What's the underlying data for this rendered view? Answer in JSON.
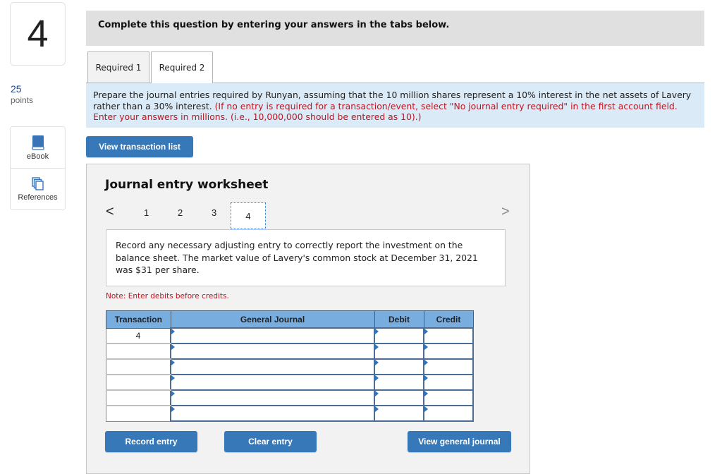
{
  "sidebar": {
    "question_number": "4",
    "points_value": "25",
    "points_label": "points",
    "tools": [
      {
        "label": "eBook",
        "icon": "book-icon"
      },
      {
        "label": "References",
        "icon": "references-icon"
      }
    ]
  },
  "header": {
    "instruction": "Complete this question by entering your answers in the tabs below."
  },
  "tabs": [
    {
      "label": "Required 1",
      "active": false
    },
    {
      "label": "Required 2",
      "active": true
    }
  ],
  "instructions": {
    "main": "Prepare the journal entries required by Runyan, assuming that the 10 million shares represent a 10% interest in the net assets of Lavery rather than a 30% interest.",
    "note": "(If no entry is required for a transaction/event, select \"No journal entry required\" in the first account field. Enter your answers in millions. (i.e., 10,000,000 should be entered as 10).)"
  },
  "buttons": {
    "view_transaction_list": "View transaction list",
    "record_entry": "Record entry",
    "clear_entry": "Clear entry",
    "view_general_journal": "View general journal"
  },
  "worksheet": {
    "title": "Journal entry worksheet",
    "pager": {
      "prev": "<",
      "next": ">",
      "pages": [
        "1",
        "2",
        "3",
        "4"
      ],
      "current": "4"
    },
    "prompt": "Record any necessary adjusting entry to correctly report the investment on the balance sheet. The market value of Lavery's common stock at December 31, 2021 was $31 per share.",
    "note": "Note: Enter debits before credits.",
    "table": {
      "headers": [
        "Transaction",
        "General Journal",
        "Debit",
        "Credit"
      ],
      "rows": [
        {
          "transaction": "4",
          "account": "",
          "debit": "",
          "credit": ""
        },
        {
          "transaction": "",
          "account": "",
          "debit": "",
          "credit": ""
        },
        {
          "transaction": "",
          "account": "",
          "debit": "",
          "credit": ""
        },
        {
          "transaction": "",
          "account": "",
          "debit": "",
          "credit": ""
        },
        {
          "transaction": "",
          "account": "",
          "debit": "",
          "credit": ""
        },
        {
          "transaction": "",
          "account": "",
          "debit": "",
          "credit": ""
        }
      ]
    }
  },
  "colors": {
    "primary_button": "#3778b9",
    "header_blue": "#78ade0",
    "instruction_bg": "#daeaf7",
    "warning_red": "#c0151f",
    "points_blue": "#1f4e8c"
  }
}
